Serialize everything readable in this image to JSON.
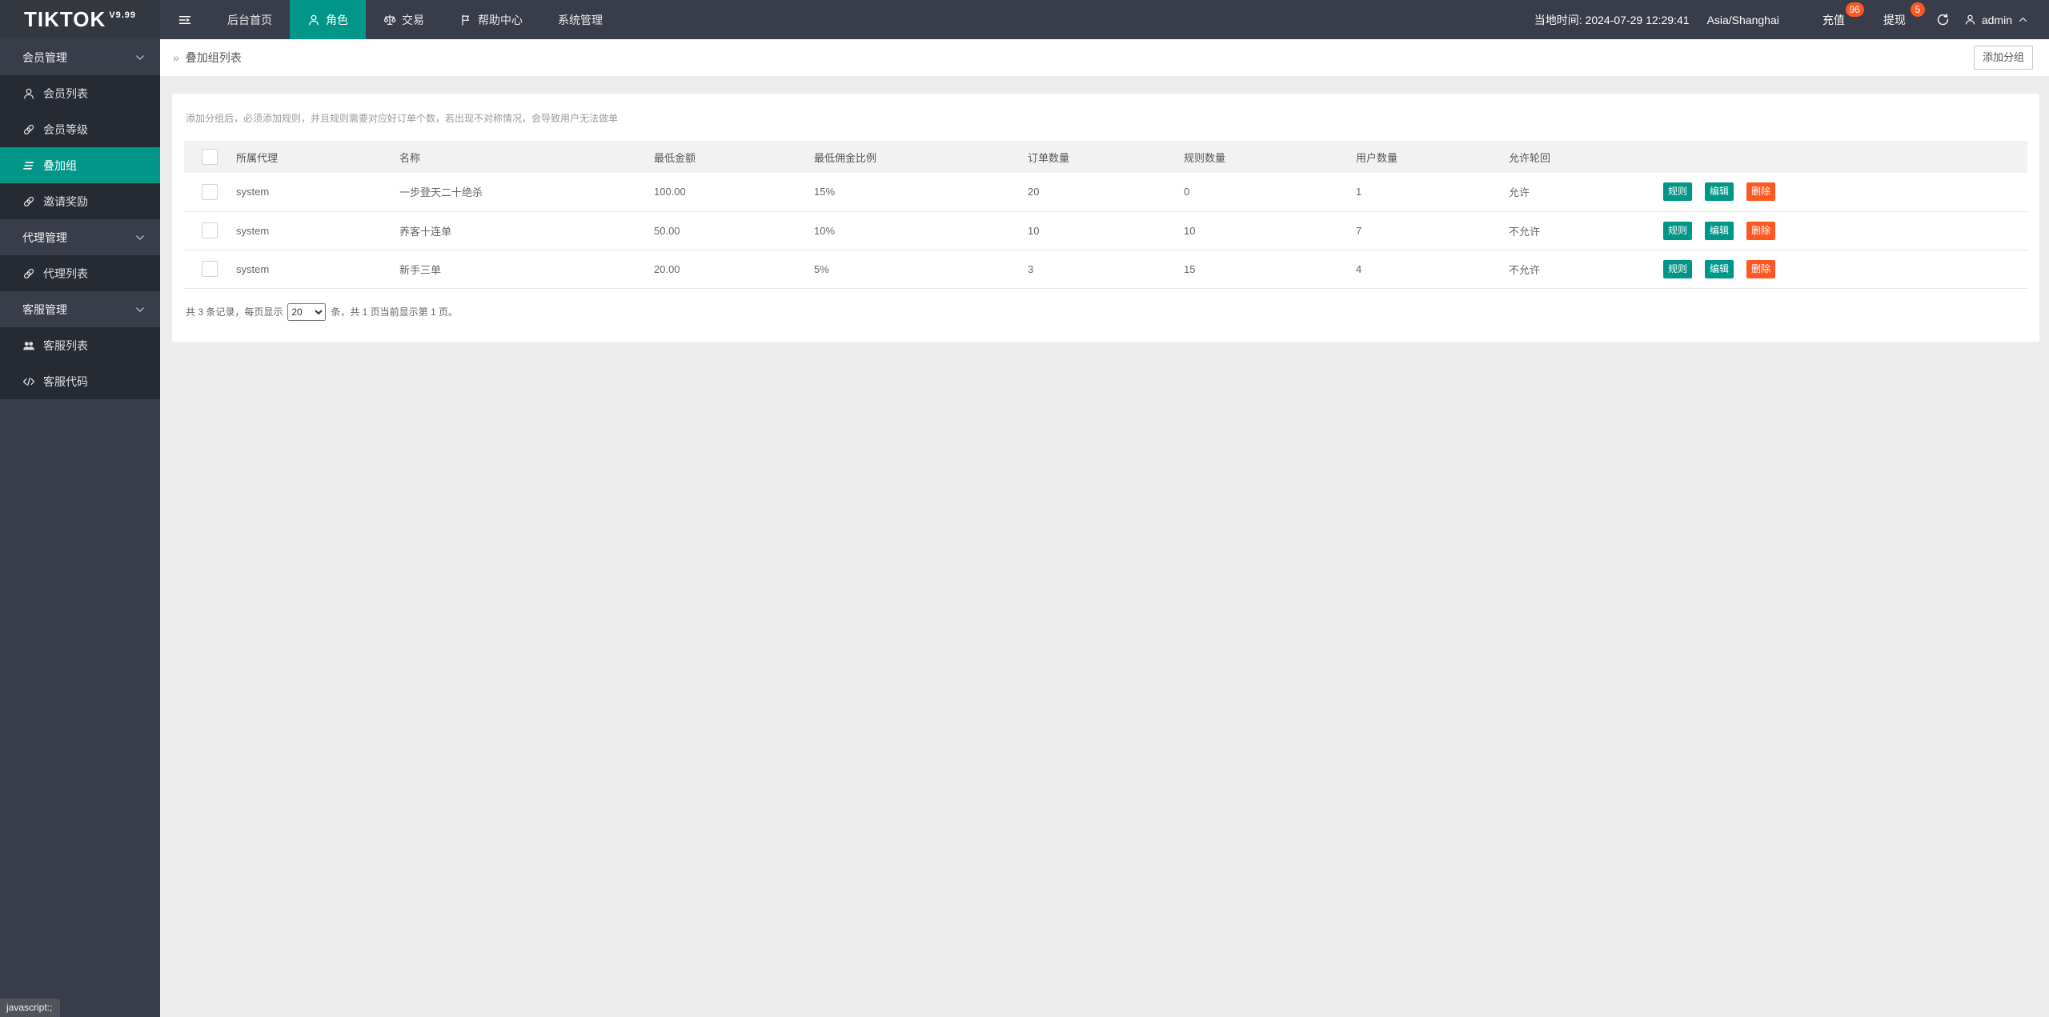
{
  "header": {
    "logo": "TIKTOK",
    "logo_version": "V9.99",
    "nav": [
      {
        "label": "后台首页",
        "icon": null,
        "active": false
      },
      {
        "label": "角色",
        "icon": "person",
        "active": true
      },
      {
        "label": "交易",
        "icon": "scales",
        "active": false
      },
      {
        "label": "帮助中心",
        "icon": "flag",
        "active": false
      },
      {
        "label": "系统管理",
        "icon": null,
        "active": false
      }
    ],
    "local_time": "当地时间: 2024-07-29 12:29:41",
    "timezone": "Asia/Shanghai",
    "recharge_label": "充值",
    "recharge_badge": "96",
    "withdraw_label": "提现",
    "withdraw_badge": "5",
    "username": "admin"
  },
  "sidebar": {
    "groups": [
      {
        "label": "会员管理",
        "items": [
          {
            "label": "会员列表",
            "icon": "person",
            "active": false
          },
          {
            "label": "会员等级",
            "icon": "link",
            "active": false
          },
          {
            "label": "叠加组",
            "icon": "list-slant",
            "active": true
          },
          {
            "label": "邀请奖励",
            "icon": "link",
            "active": false
          }
        ]
      },
      {
        "label": "代理管理",
        "items": [
          {
            "label": "代理列表",
            "icon": "link",
            "active": false
          }
        ]
      },
      {
        "label": "客服管理",
        "items": [
          {
            "label": "客服列表",
            "icon": "people",
            "active": false
          },
          {
            "label": "客服代码",
            "icon": "code",
            "active": false
          }
        ]
      }
    ]
  },
  "breadcrumb": {
    "separator": "»",
    "current": "叠加组列表"
  },
  "toolbar": {
    "add_group_label": "添加分组"
  },
  "content": {
    "hint": "添加分组后，必须添加规则，并且规则需要对应好订单个数，若出现不对称情况，会导致用户无法做单"
  },
  "table": {
    "columns": [
      "所属代理",
      "名称",
      "最低金额",
      "最低佣金比例",
      "订单数量",
      "规则数量",
      "用户数量",
      "允许轮回"
    ],
    "action_labels": {
      "rule": "规则",
      "edit": "编辑",
      "delete": "删除"
    },
    "rows": [
      {
        "agent": "system",
        "name": "一步登天二十绝杀",
        "min_amount": "100.00",
        "min_commission": "15%",
        "orders": "20",
        "rules": "0",
        "users": "1",
        "recycle": "允许"
      },
      {
        "agent": "system",
        "name": "养客十连单",
        "min_amount": "50.00",
        "min_commission": "10%",
        "orders": "10",
        "rules": "10",
        "users": "7",
        "recycle": "不允许"
      },
      {
        "agent": "system",
        "name": "新手三单",
        "min_amount": "20.00",
        "min_commission": "5%",
        "orders": "3",
        "rules": "15",
        "users": "4",
        "recycle": "不允许"
      }
    ]
  },
  "pagination": {
    "prefix": "共 3 条记录，每页显示",
    "page_size": "20",
    "suffix": "条，共 1 页当前显示第 1 页。"
  },
  "status_bar": "javascript:;",
  "colors": {
    "accent": "#009688",
    "danger": "#FF5722",
    "header_bg": "#393D49",
    "submenu_bg": "#262a32",
    "table_header_bg": "#f2f2f2"
  }
}
